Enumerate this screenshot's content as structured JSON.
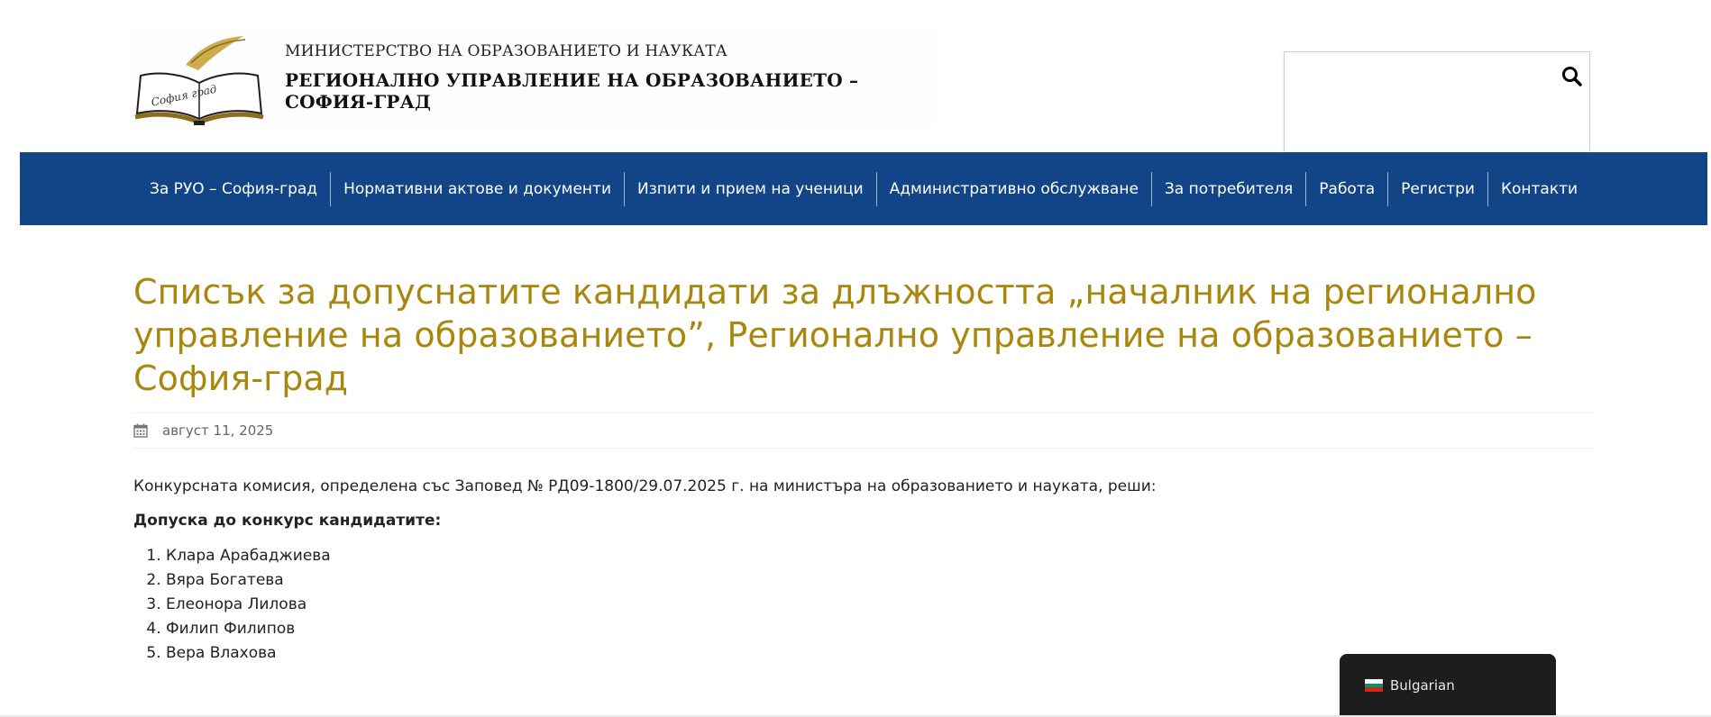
{
  "header": {
    "logo": {
      "emblem_text": "София град",
      "line1": "МИНИСТЕРСТВО НА ОБРАЗОВАНИЕТО И НАУКАТА",
      "line2": "РЕГИОНАЛНО УПРАВЛЕНИЕ НА ОБРАЗОВАНИЕТО – СОФИЯ-ГРАД"
    },
    "search": {
      "value": "",
      "placeholder": "",
      "icon": "search-icon"
    }
  },
  "nav": {
    "items": [
      "За РУО – София-град",
      "Нормативни актове и документи",
      "Изпити и прием на ученици",
      "Административно обслужване",
      "За потребителя",
      "Работа",
      "Регистри",
      "Контакти"
    ]
  },
  "article": {
    "title": "Списък за допуснатите кандидати за длъжността „началник на регионално управление на образованието”, Регионално управление на образованието – София-град",
    "date": "август 11, 2025",
    "date_icon": "calendar-icon",
    "intro": "Конкурсната комисия, определена със Заповед № РД09-1800/29.07.2025 г. на министъра на образованието и науката, реши:",
    "admit_heading": "Допуска до конкурс кандидатите:",
    "candidates": [
      "Клара Арабаджиева",
      "Вяра Богатева",
      "Елеонора Лилова",
      "Филип Филипов",
      "Вера Влахова"
    ]
  },
  "language": {
    "label": "Bulgarian",
    "flag_icon": "bulgarian-flag-icon"
  },
  "colors": {
    "nav_bg": "#124587",
    "title": "#a8870f",
    "lang_bg": "#1d1d1d"
  }
}
